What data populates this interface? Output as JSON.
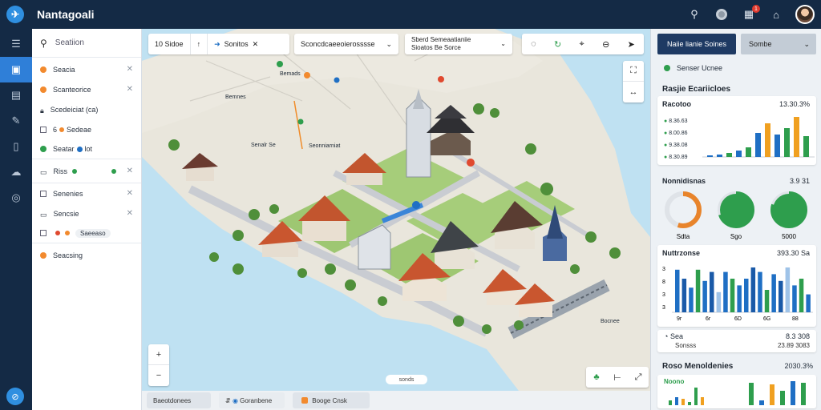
{
  "app": {
    "title": "Nantagoali"
  },
  "top_icons": [
    "search-icon",
    "record-icon",
    "calendar-icon",
    "bell-icon"
  ],
  "notification_count": "1",
  "rail": [
    "layers-icon",
    "map-icon",
    "document-icon",
    "edit-icon",
    "panel-icon",
    "cloud-icon",
    "compass-icon"
  ],
  "layers_panel": {
    "search_placeholder": "Seatiion",
    "items": [
      {
        "label": "Seacia",
        "color": "#f28a2e"
      },
      {
        "label": "Scanteorice",
        "color": "#f28a2e"
      },
      {
        "label": "Scedeiciat (ca)",
        "color": "#ffffff"
      },
      {
        "label": "Sedeae",
        "tag": "6",
        "color": "#f28a2e"
      },
      {
        "label": "Seatar",
        "tag": "lot",
        "color": "#2e9e4d"
      },
      {
        "label": "Riss",
        "color": "#2e9e4d"
      },
      {
        "label": "Senenies",
        "color": "#ffffff"
      },
      {
        "label": "Sencsie",
        "color": "#ffffff"
      },
      {
        "label": "Saeeaso",
        "color": "#e0492f"
      },
      {
        "label": "Seacsing",
        "color": "#f28a2e"
      }
    ]
  },
  "map_toolbar": {
    "group1": [
      "10",
      "Sidoe",
      "1",
      "Sonitos"
    ],
    "dropdown1": "Sconcdcaeeoierosssse",
    "dropdown2_line1": "Sberd Semeaatianiie",
    "dropdown2_line2": "Sioatos Be Sorce",
    "tools": [
      "pin-icon",
      "refresh-icon",
      "location-icon",
      "minus-circle-icon",
      "navigate-icon"
    ]
  },
  "map_labels": [
    "Bemads",
    "Bemnes",
    "Senalr Se",
    "Seonniarniat",
    "Bocnee"
  ],
  "map_scale": "sonds",
  "bottom_bar": [
    "Baeotdonees",
    "Goranbene",
    "Booge Cnsk"
  ],
  "right_panel": {
    "primary_button": "Naiie lianie Soines",
    "select_button": "Sombe",
    "status": "Senser Ucnee",
    "section_title": "Rasjie Ecariicloes",
    "card1": {
      "title": "Racotoo",
      "value": "13.30.3%",
      "legend": [
        "8.36.63",
        "8.00.86",
        "9.38.08",
        "8.30.89"
      ],
      "chart_values": [
        2,
        3,
        5,
        8,
        12,
        30,
        42,
        28,
        36,
        50,
        26
      ]
    },
    "card2": {
      "title": "Nonnidisnas",
      "value": "3.9 31",
      "gauges": [
        {
          "label": "Sdta",
          "pct": 0.55,
          "color": "#e8842b"
        },
        {
          "label": "Sgo",
          "pct": 0.7,
          "color": "#2e9e4d"
        },
        {
          "label": "5000",
          "pct": 0.8,
          "color": "#2e9e4d"
        }
      ]
    },
    "card3": {
      "title": "Nuttrzonse",
      "value": "393.30 Sa",
      "ytick": [
        "3",
        "8",
        "3",
        "3"
      ],
      "xtick": [
        "9r",
        "6r",
        "6D",
        "6G",
        "88"
      ],
      "chart_values": [
        38,
        30,
        22,
        38,
        28,
        36,
        18,
        36,
        30,
        24,
        30,
        40,
        36,
        20,
        34,
        28,
        40,
        24,
        30,
        16
      ]
    },
    "summary": {
      "left": "Sea",
      "left_sub": "Sonsss",
      "right": "8.3 308",
      "right_sub": "23.89 3083"
    },
    "card4": {
      "title": "Roso Menoldenies",
      "value": "2030.3%",
      "legend": "Noono",
      "chart_values": [
        6,
        10,
        8,
        4,
        22,
        10,
        28,
        6,
        26,
        18,
        30,
        28
      ]
    }
  }
}
